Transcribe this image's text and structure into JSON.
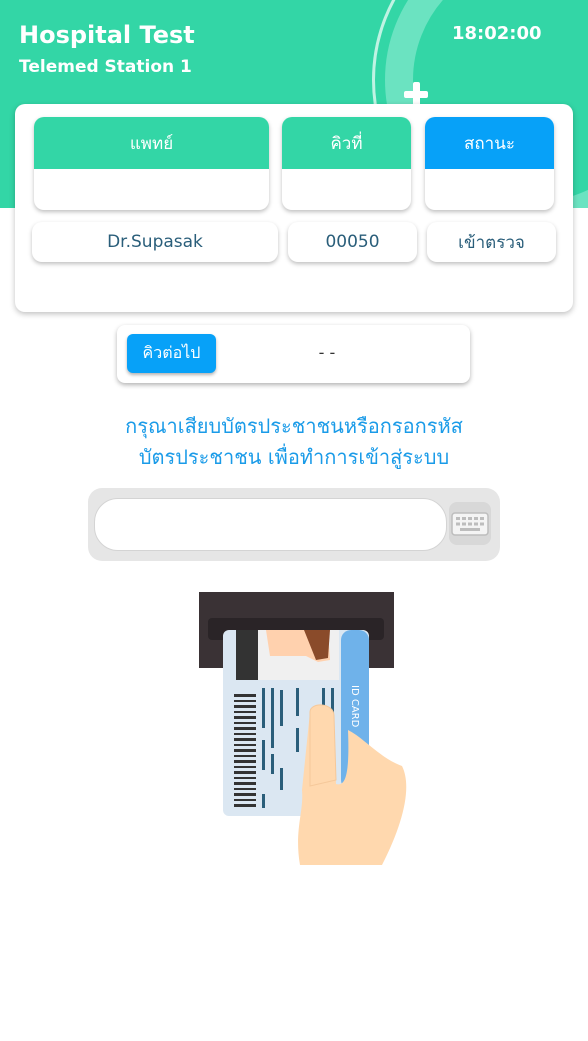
{
  "header": {
    "title": "Hospital Test",
    "subtitle": "Telemed Station 1",
    "clock": "18:02:00"
  },
  "queue_table": {
    "columns": [
      {
        "label": "แพทย์",
        "value": "Dr.Supasak"
      },
      {
        "label": "คิวที่",
        "value": "00050"
      },
      {
        "label": "สถานะ",
        "value": "เข้าตรวจ"
      }
    ]
  },
  "next_queue": {
    "button_label": "คิวต่อไป",
    "value": "- -"
  },
  "instruction": {
    "line1": "กรุณาเสียบบัตรประชาชนหรือกรอกรหัส",
    "line2": "บัตรประชาชน เพื่อทำการเข้าสู่ระบบ"
  },
  "id_input": {
    "value": "",
    "placeholder": ""
  },
  "illustration": {
    "card_text": "ID CARD"
  },
  "colors": {
    "green": "#33d6a6",
    "blue": "#07a1f8",
    "text_dark": "#2a5e7a"
  }
}
